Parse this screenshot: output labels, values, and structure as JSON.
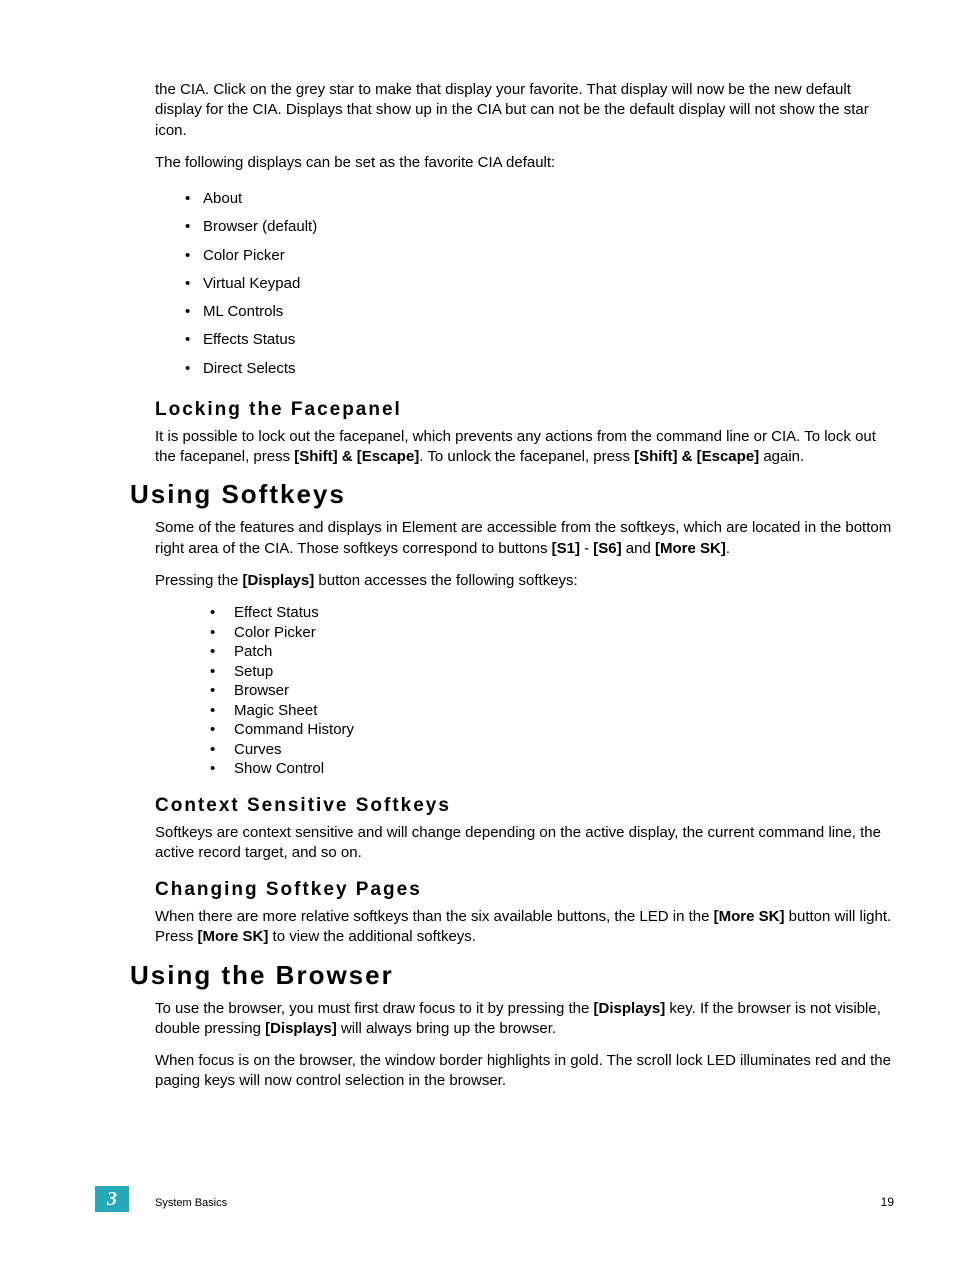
{
  "intro": {
    "p1": "the CIA. Click on the grey star to make that display your favorite. That display will now be the new default display for the CIA. Displays that show up in the CIA but can not be the default display will not show the star icon.",
    "p2": "The following displays can be set as the favorite CIA default:",
    "list": [
      "About",
      "Browser (default)",
      "Color Picker",
      "Virtual Keypad",
      "ML Controls",
      "Effects Status",
      "Direct Selects"
    ]
  },
  "locking": {
    "heading": "Locking the Facepanel",
    "p1_a": "It is possible to lock out the facepanel, which prevents any actions from the command line or CIA. To lock out the facepanel, press ",
    "p1_b": "[Shift] & [Escape]",
    "p1_c": ". To unlock the facepanel, press ",
    "p1_d": "[Shift] & [Escape]",
    "p1_e": " again."
  },
  "using_softkeys": {
    "heading": "Using Softkeys",
    "p1_a": "Some of the features and displays in Element are accessible from the softkeys, which are located in the bottom right area of the CIA. Those softkeys correspond to buttons ",
    "p1_b": "[S1]",
    "p1_c": " - ",
    "p1_d": "[S6]",
    "p1_e": " and ",
    "p1_f": "[More SK]",
    "p1_g": ".",
    "p2_a": "Pressing the ",
    "p2_b": "[Displays]",
    "p2_c": " button accesses the following softkeys:",
    "list": [
      "Effect Status",
      "Color Picker",
      "Patch",
      "Setup",
      "Browser",
      "Magic Sheet",
      "Command History",
      "Curves",
      "Show Control"
    ]
  },
  "context": {
    "heading": "Context Sensitive Softkeys",
    "p1": "Softkeys are context sensitive and will change depending on the active display, the current command line, the active record target, and so on."
  },
  "changing": {
    "heading": "Changing Softkey Pages",
    "p1_a": "When there are more relative softkeys than the six available buttons, the LED in the ",
    "p1_b": "[More SK]",
    "p1_c": " button will light. Press ",
    "p1_d": "[More SK]",
    "p1_e": " to view the additional softkeys."
  },
  "browser": {
    "heading": "Using the Browser",
    "p1_a": "To use the browser, you must first draw focus to it by pressing the ",
    "p1_b": "[Displays]",
    "p1_c": " key. If the browser is not visible, double pressing ",
    "p1_d": "[Displays]",
    "p1_e": " will always bring up the browser.",
    "p2": "When focus is on the browser, the window border highlights in gold. The scroll lock LED illuminates red and the paging keys will now control selection in the browser."
  },
  "footer": {
    "chapter": "3",
    "label": "System Basics",
    "page": "19"
  }
}
